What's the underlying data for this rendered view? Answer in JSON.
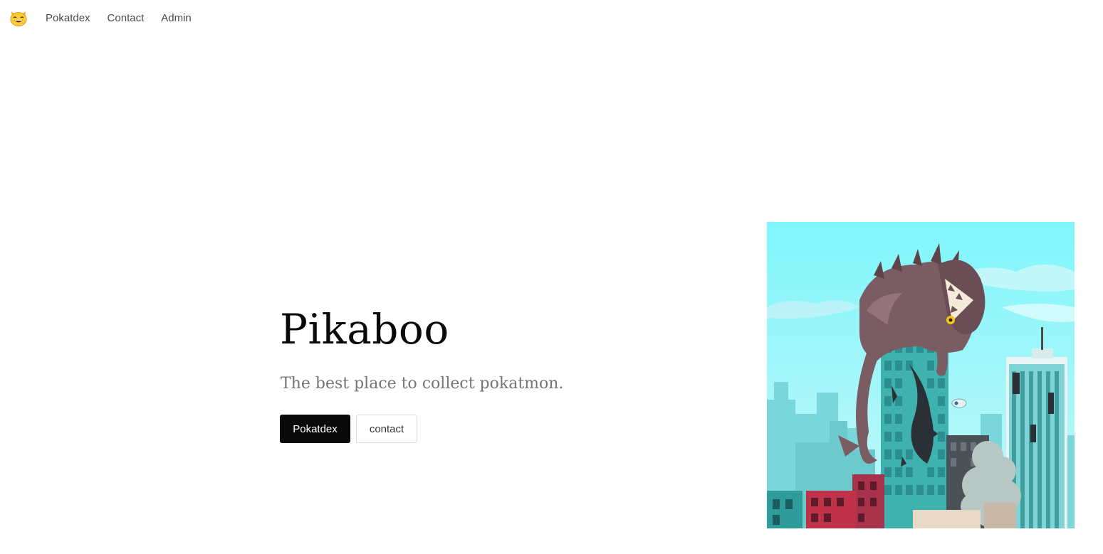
{
  "navbar": {
    "brand_icon": "cat-face-icon",
    "links": [
      {
        "label": "Pokatdex"
      },
      {
        "label": "Contact"
      },
      {
        "label": "Admin"
      }
    ]
  },
  "hero": {
    "title": "Pikaboo",
    "subtitle": "The best place to collect pokatmon.",
    "primary_button": "Pokatdex",
    "secondary_button": "contact",
    "image": "monster-on-city-illustration"
  },
  "colors": {
    "primary_button_bg": "#0a0a0a",
    "sky": "#7ff4f8",
    "monster": "#7a5c63"
  }
}
